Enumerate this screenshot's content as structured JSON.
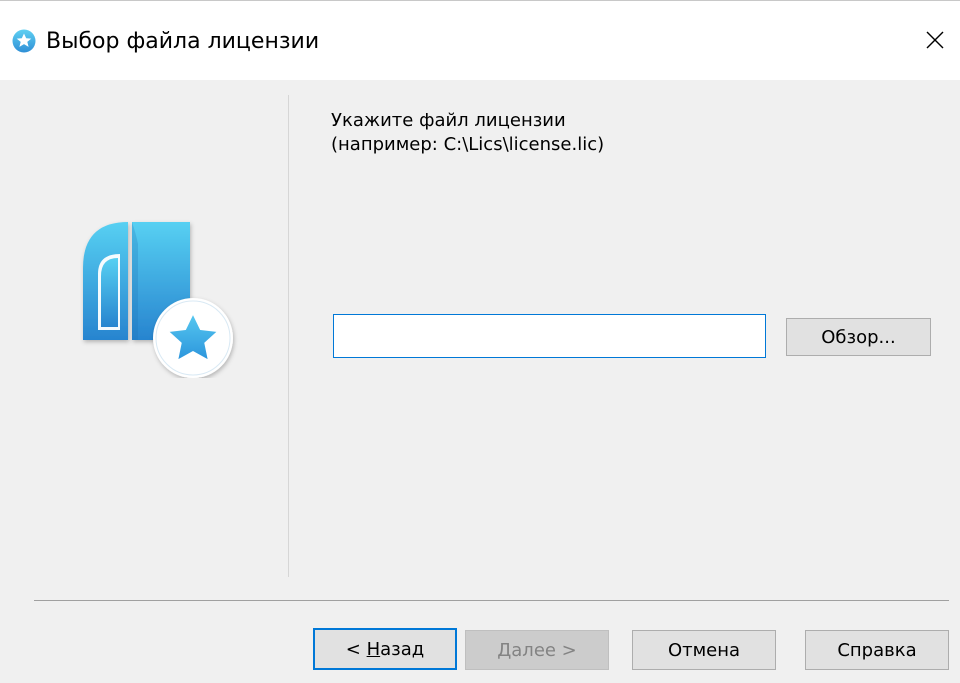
{
  "window": {
    "title": "Выбор файла лицензии",
    "icon": "star-badge-icon",
    "close_glyph": "✕"
  },
  "content": {
    "prompt_line1": "Укажите файл лицензии",
    "prompt_line2": "(например: C:\\Lics\\license.lic)",
    "path_value": "",
    "browse_label": "Обзор..."
  },
  "buttons": {
    "back_prefix": "< ",
    "back_mnemonic": "Н",
    "back_rest": "азад",
    "next_mnemonic": "Д",
    "next_rest": "алее >",
    "cancel_label": "Отмена",
    "help_label": "Справка"
  },
  "colors": {
    "accent": "#0078d7",
    "logo_gradient_top": "#4fc8ef",
    "logo_gradient_bottom": "#2a86d1",
    "star": "#3bb0e8"
  }
}
